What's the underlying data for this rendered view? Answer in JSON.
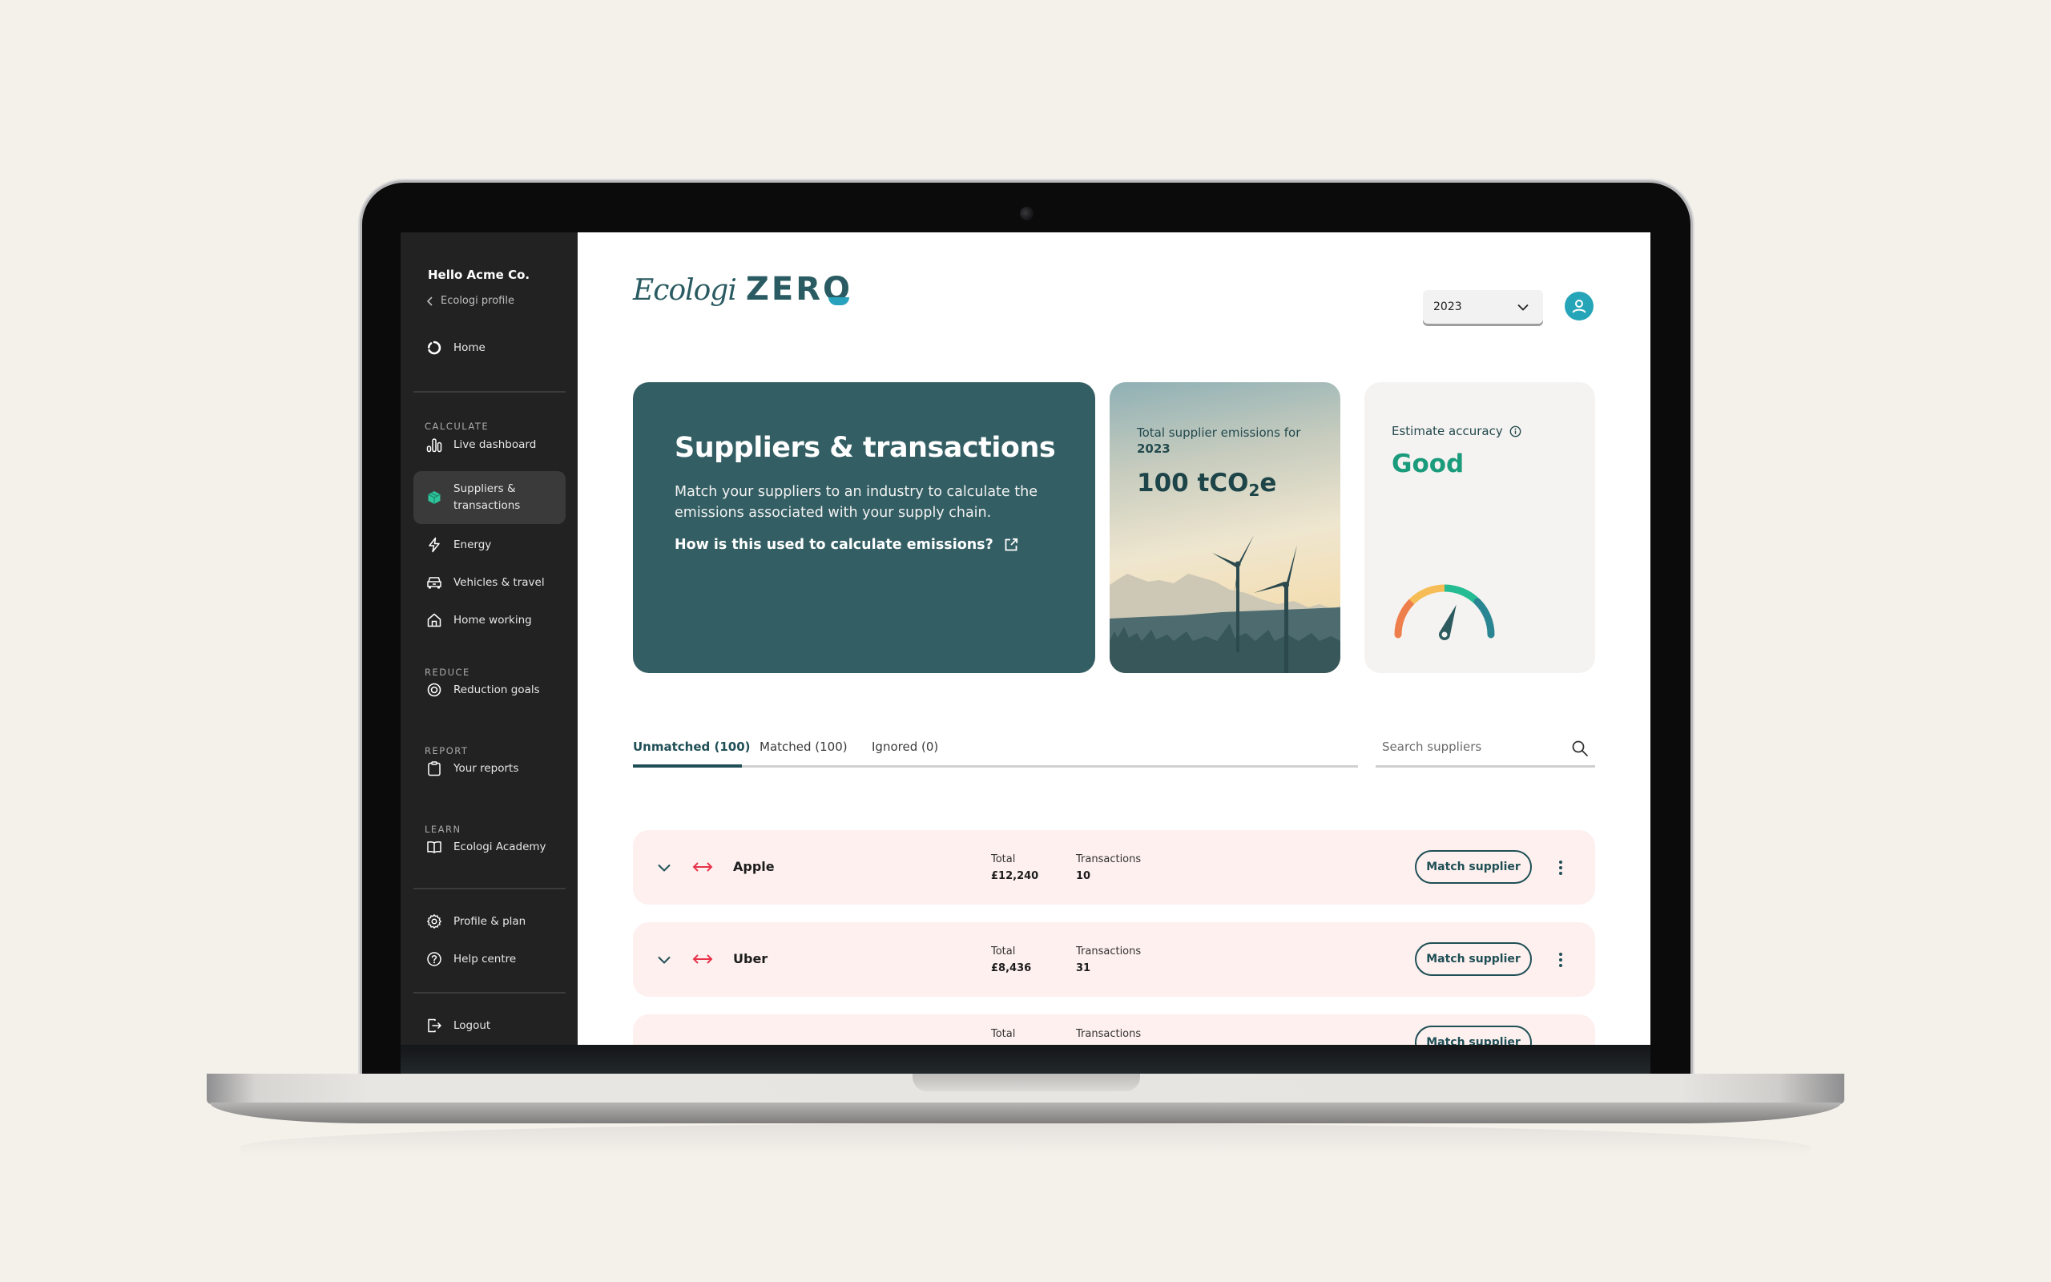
{
  "sidebar": {
    "greeting": "Hello Acme Co.",
    "back_link": "Ecologi profile",
    "home": {
      "label": "Home",
      "icon": "ecologi-circle-icon"
    },
    "sections": [
      {
        "label": "CALCULATE",
        "items": [
          {
            "label": "Live dashboard",
            "icon": "bar-chart-icon"
          },
          {
            "label": "Suppliers & transactions",
            "icon": "box-icon",
            "active": true
          },
          {
            "label": "Energy",
            "icon": "lightning-icon"
          },
          {
            "label": "Vehicles & travel",
            "icon": "car-icon"
          },
          {
            "label": "Home working",
            "icon": "house-icon"
          }
        ]
      },
      {
        "label": "REDUCE",
        "items": [
          {
            "label": "Reduction goals",
            "icon": "target-icon"
          }
        ]
      },
      {
        "label": "REPORT",
        "items": [
          {
            "label": "Your reports",
            "icon": "clipboard-icon"
          }
        ]
      },
      {
        "label": "LEARN",
        "items": [
          {
            "label": "Ecologi Academy",
            "icon": "book-icon"
          }
        ]
      }
    ],
    "footer_items": [
      {
        "label": "Profile & plan",
        "icon": "gear-icon"
      },
      {
        "label": "Help centre",
        "icon": "help-icon"
      }
    ],
    "logout": {
      "label": "Logout",
      "icon": "logout-icon"
    }
  },
  "header": {
    "logo_script": "Ecologi",
    "logo_bold": "ZERO",
    "year_select": {
      "value": "2023",
      "icon": "chevron-down-icon"
    },
    "avatar_icon": "user-icon"
  },
  "hero": {
    "title": "Suppliers & transactions",
    "description": "Match your suppliers to an industry to calculate the emissions associated with your supply chain.",
    "link_label": "How is this used to calculate emissions?",
    "link_icon": "external-link-icon"
  },
  "emissions_card": {
    "label": "Total supplier emissions for",
    "year": "2023",
    "value": "100",
    "unit_prefix": "tCO",
    "unit_sub": "2",
    "unit_suffix": "e"
  },
  "accuracy_card": {
    "label": "Estimate accuracy",
    "info_icon": "info-icon",
    "value": "Good",
    "gauge_level": 0.62,
    "gauge_colors": [
      "#ee7f4d",
      "#f6bd57",
      "#26bc93",
      "#2a8593"
    ]
  },
  "tabs": [
    {
      "label": "Unmatched (100)",
      "active": true
    },
    {
      "label": "Matched (100)",
      "active": false
    },
    {
      "label": "Ignored (0)",
      "active": false
    }
  ],
  "search": {
    "placeholder": "Search suppliers",
    "value": "",
    "icon": "search-icon"
  },
  "suppliers": {
    "total_label": "Total",
    "transactions_label": "Transactions",
    "action_label": "Match supplier",
    "rows": [
      {
        "name": "Apple",
        "total": "£12,240",
        "transactions": "10"
      },
      {
        "name": "Uber",
        "total": "£8,436",
        "transactions": "31"
      },
      {
        "name": "",
        "total": "",
        "transactions": ""
      }
    ]
  },
  "colors": {
    "brand_teal": "#335e63",
    "accent_teal": "#27a5b8",
    "good_green": "#1a9b7c",
    "row_bg": "#fdf0ee",
    "unmatched_red": "#e8334a",
    "sidebar_bg": "#222222"
  }
}
